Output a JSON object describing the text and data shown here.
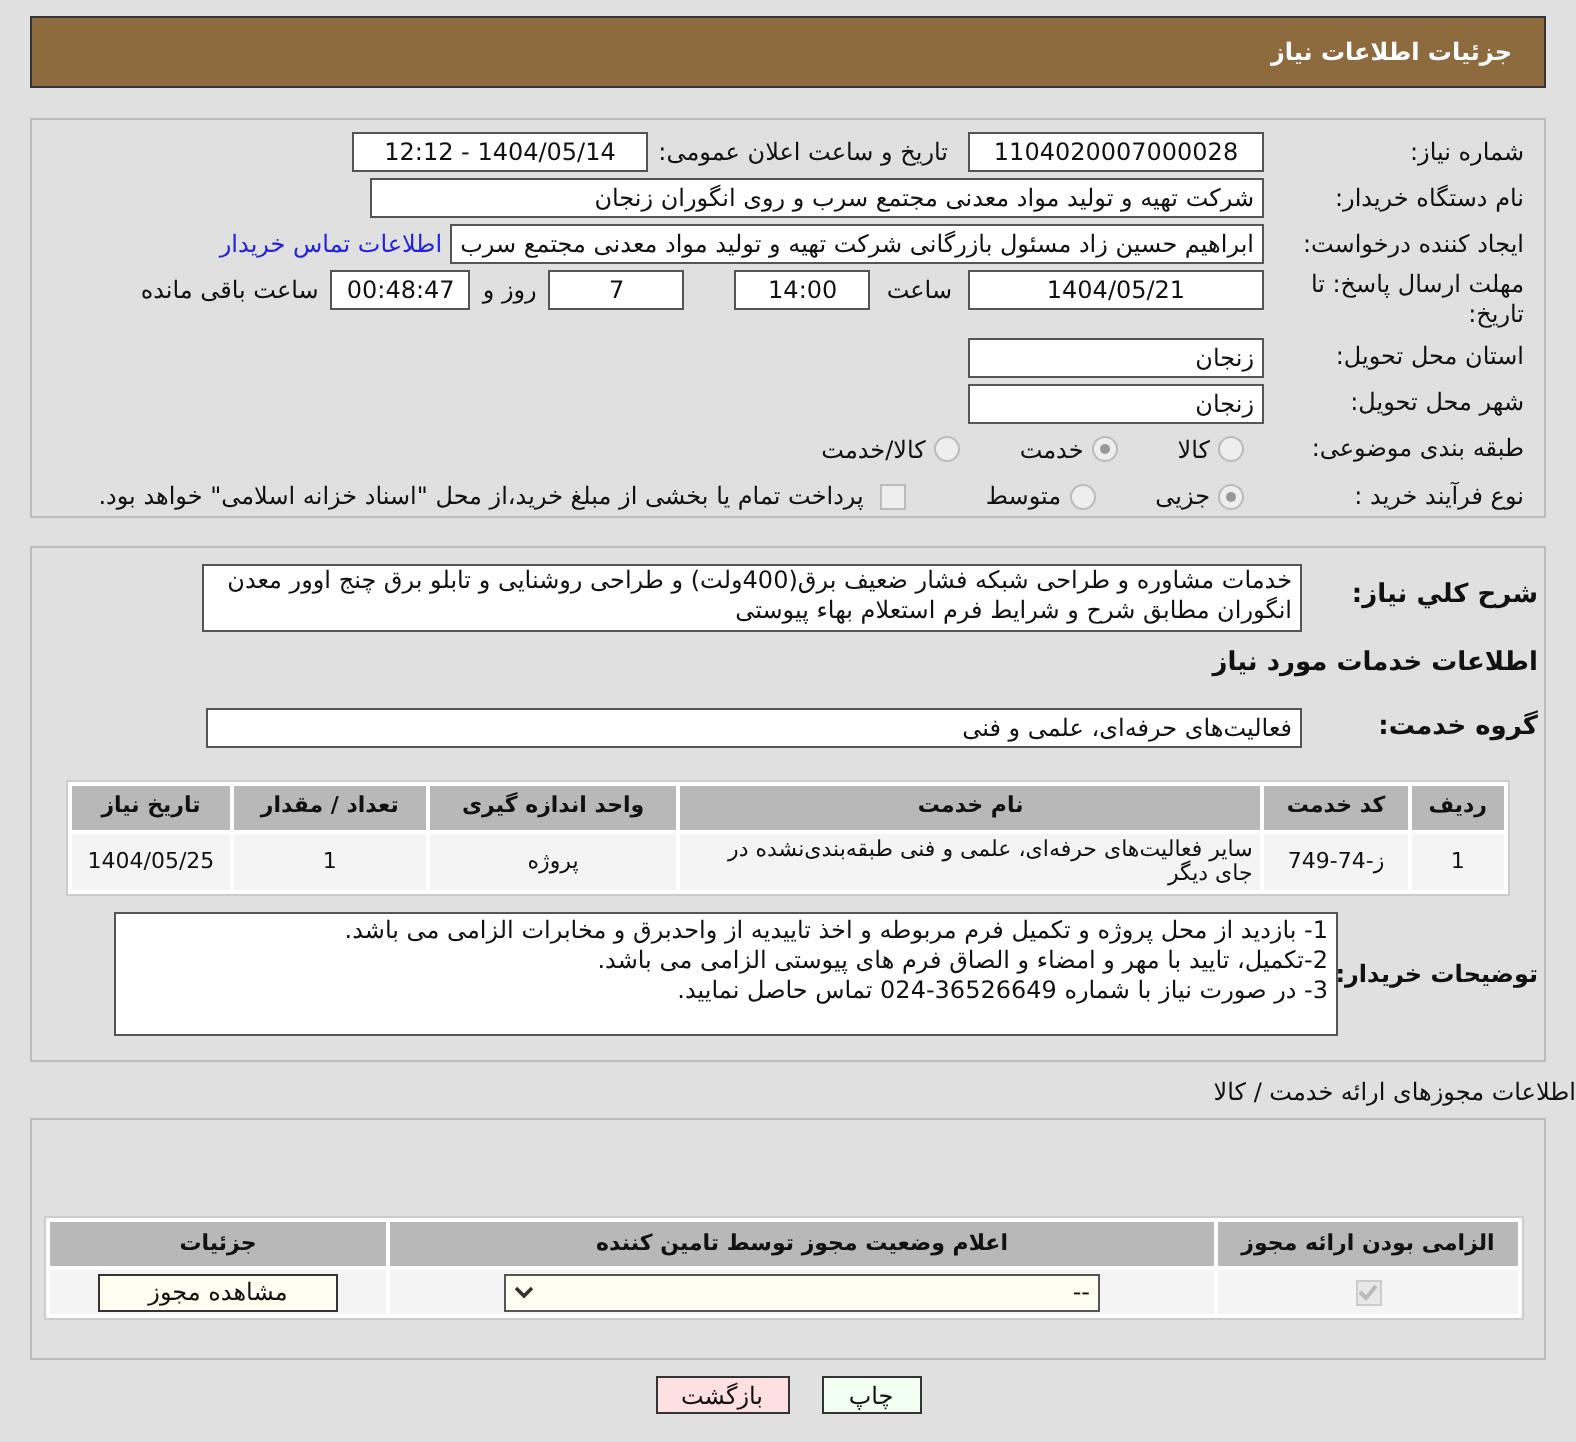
{
  "header": {
    "title": "جزئیات اطلاعات نیاز"
  },
  "need_number": {
    "label": "شماره نیاز:",
    "value": "1104020007000028"
  },
  "announce": {
    "label": "تاریخ و ساعت اعلان عمومی:",
    "value": "1404/05/14 - 12:12"
  },
  "buyer": {
    "label": "نام دستگاه خریدار:",
    "value": "شرکت تهیه و تولید مواد معدنی مجتمع سرب و روی انگوران   زنجان"
  },
  "requester": {
    "label": "ایجاد کننده درخواست:",
    "value": "ابراهیم حسین زاد مسئول بازرگانی شرکت تهیه و تولید مواد معدنی مجتمع سرب",
    "link": "اطلاعات تماس خریدار"
  },
  "deadline": {
    "label": "مهلت ارسال پاسخ: تا تاریخ:",
    "date": "1404/05/21",
    "time_label": "ساعت",
    "time": "14:00",
    "days": "7",
    "days_label": "روز و",
    "remaining": "00:48:47",
    "remaining_label": "ساعت باقی مانده"
  },
  "province": {
    "label": "استان محل تحویل:",
    "value": "زنجان"
  },
  "city": {
    "label": "شهر محل تحویل:",
    "value": "زنجان"
  },
  "category": {
    "label": "طبقه بندی موضوعی:",
    "options": [
      {
        "label": "کالا",
        "selected": false
      },
      {
        "label": "خدمت",
        "selected": true
      },
      {
        "label": "کالا/خدمت",
        "selected": false
      }
    ]
  },
  "purchase_type": {
    "label": "نوع فرآیند خرید :",
    "options": [
      {
        "label": "جزیی",
        "selected": true
      },
      {
        "label": "متوسط",
        "selected": false
      }
    ],
    "payment": {
      "label": "پرداخت تمام یا بخشی از مبلغ خرید،از محل \"اسناد خزانه اسلامی\" خواهد بود.",
      "checked": false
    }
  },
  "description": {
    "label": "شرح کلي نیاز:",
    "value": "خدمات مشاوره و طراحی شبکه فشار ضعیف برق(400ولت) و طراحی روشنایی و تابلو برق چنج اوور معدن انگوران مطابق شرح و شرایط فرم استعلام بهاء پیوستی"
  },
  "services_title": "اطلاعات خدمات مورد نیاز",
  "service_group": {
    "label": "گروه خدمت:",
    "value": "فعالیت‌های حرفه‌ای، علمی و فنی"
  },
  "table": {
    "columns": [
      "ردیف",
      "کد خدمت",
      "نام خدمت",
      "واحد اندازه گیری",
      "تعداد / مقدار",
      "تاریخ نیاز"
    ],
    "rows": [
      [
        "1",
        "ز-74-749",
        "سایر فعالیت‌های حرفه‌ای، علمی و فنی طبقه‌بندی‌نشده در جای دیگر",
        "پروژه",
        "1",
        "1404/05/25"
      ]
    ]
  },
  "buyer_notes": {
    "label": "توضیحات خریدار:",
    "lines": [
      "1- بازدید از محل پروژه و تکمیل فرم مربوطه و اخذ تاییدیه از واحدبرق و مخابرات الزامی می باشد.",
      "2-تکمیل، تایید با مهر و امضاء و الصاق فرم های پیوستی الزامی می باشد.",
      "3- در صورت نیاز با شماره 36526649-024 تماس حاصل نمایید."
    ]
  },
  "licenses": {
    "title": "اطلاعات مجوزهای ارائه خدمت / کالا",
    "columns": [
      "الزامی بودن ارائه مجوز",
      "اعلام وضعیت مجوز توسط تامین کننده",
      "جزئیات"
    ],
    "rows": [
      {
        "required": true,
        "status": "--",
        "button": "مشاهده مجوز"
      }
    ]
  },
  "buttons": [
    {
      "label": "چاپ",
      "kind": "print"
    },
    {
      "label": "بازگشت",
      "kind": "back"
    }
  ]
}
